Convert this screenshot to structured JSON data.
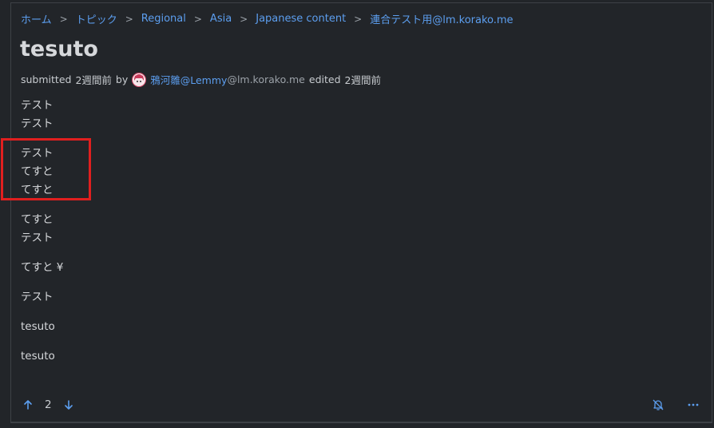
{
  "breadcrumb": {
    "items": [
      "ホーム",
      "トピック",
      "Regional",
      "Asia",
      "Japanese content",
      "連合テスト用@lm.korako.me"
    ],
    "separator": ">"
  },
  "post": {
    "title": "tesuto",
    "submitted_label": "submitted",
    "submitted_time": "2週間前",
    "by_label": "by",
    "author_name": "鴉河雛@Lemmy",
    "author_instance": "@lm.korako.me",
    "edited_label": "edited",
    "edited_time": "2週間前",
    "paragraphs": [
      [
        "テスト",
        "テスト"
      ],
      [
        "テスト",
        "てすと",
        "てすと"
      ],
      [
        "てすと",
        "テスト"
      ],
      [
        "てすと ¥"
      ],
      [
        "テスト"
      ],
      [
        "tesuto"
      ],
      [
        "tesuto"
      ]
    ],
    "score": "2"
  },
  "colors": {
    "background": "#222529",
    "link": "#5c9eef",
    "text": "#d6d8db",
    "highlight": "#e01f1f"
  },
  "icons": {
    "upvote": "arrow-up-icon",
    "downvote": "arrow-down-icon",
    "notifications": "bell-off-icon",
    "more": "more-horizontal-icon"
  }
}
